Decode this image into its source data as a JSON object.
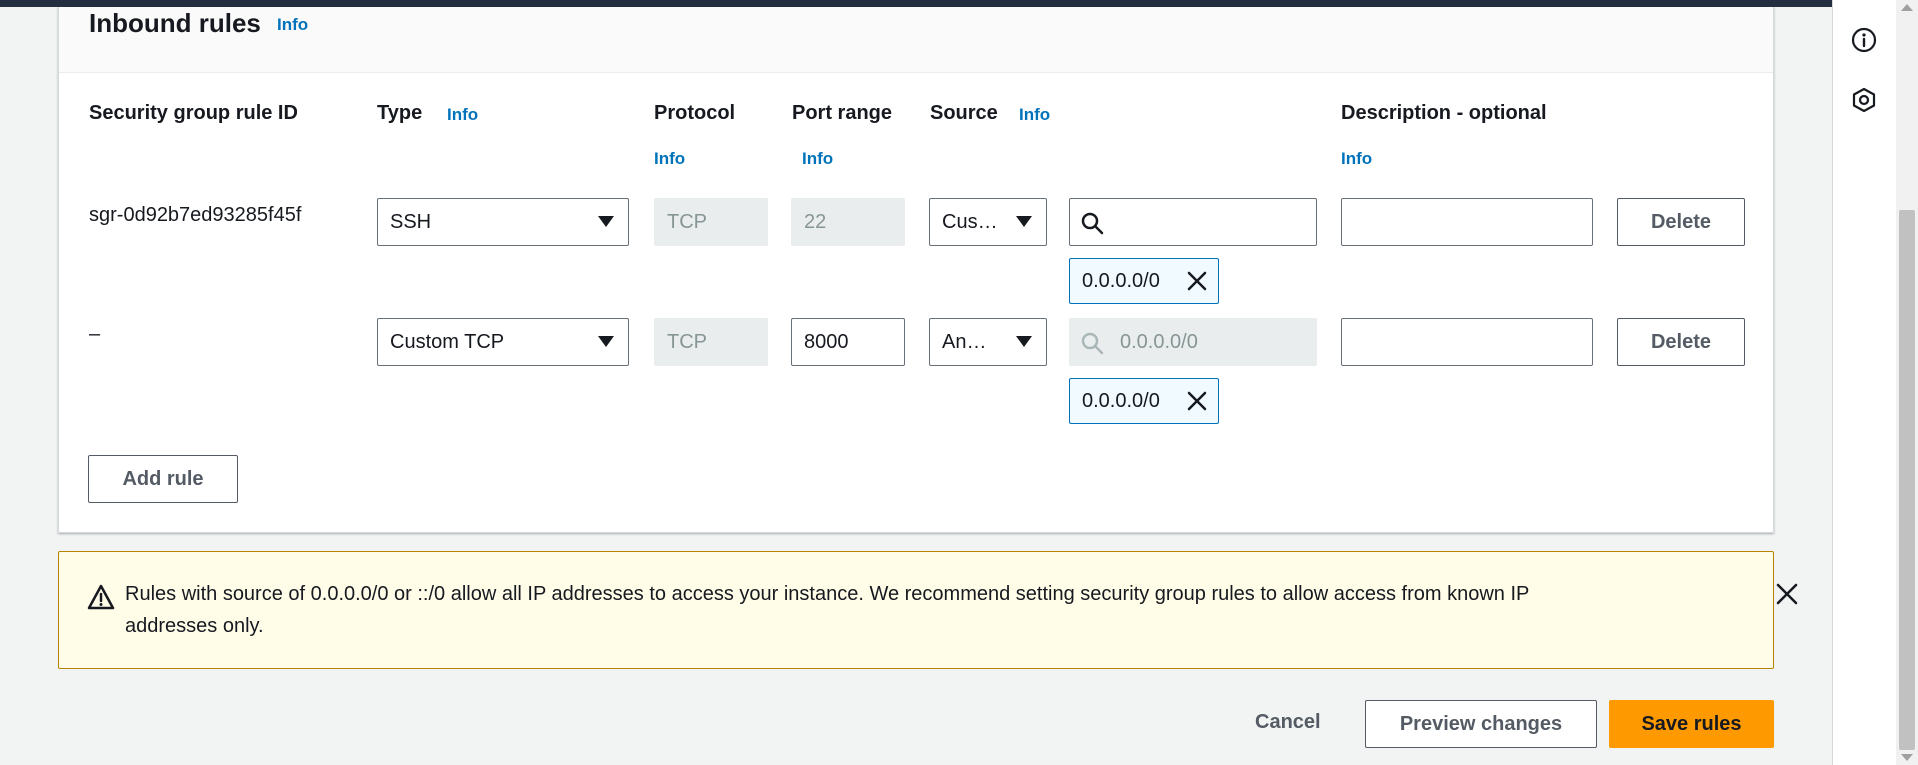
{
  "panel": {
    "title": "Inbound rules",
    "title_info": "Info"
  },
  "columns": {
    "rule_id": "Security group rule ID",
    "type": "Type",
    "type_info": "Info",
    "protocol": "Protocol",
    "protocol_info": "Info",
    "port_range": "Port range",
    "port_range_info": "Info",
    "source": "Source",
    "source_info": "Info",
    "description": "Description - optional",
    "description_info": "Info"
  },
  "rules": [
    {
      "rule_id": "sgr-0d92b7ed93285f45f",
      "type": "SSH",
      "protocol": "TCP",
      "port_range": "22",
      "source": "Cus…",
      "cidr_search_value": "",
      "cidr_search_placeholder": "",
      "token": "0.0.0.0/0",
      "description": "",
      "delete_label": "Delete"
    },
    {
      "rule_id": "–",
      "type": "Custom TCP",
      "protocol": "TCP",
      "port_range": "8000",
      "source": "An…",
      "cidr_search_value": "0.0.0.0/0",
      "token": "0.0.0.0/0",
      "description": "",
      "delete_label": "Delete"
    }
  ],
  "add_rule_label": "Add rule",
  "alert": {
    "text": "Rules with source of 0.0.0.0/0 or ::/0 allow all IP addresses to access your instance. We recommend setting security group rules to allow access from known IP addresses only."
  },
  "footer": {
    "cancel": "Cancel",
    "preview": "Preview changes",
    "save": "Save rules"
  },
  "colors": {
    "link": "#0073bb",
    "primary": "#ff9900",
    "warning_bg": "#fffce8",
    "warning_border": "#b58500"
  },
  "icons": [
    "search-icon",
    "close-icon",
    "warning-icon",
    "info-icon",
    "settings-icon",
    "caret-down-icon"
  ]
}
